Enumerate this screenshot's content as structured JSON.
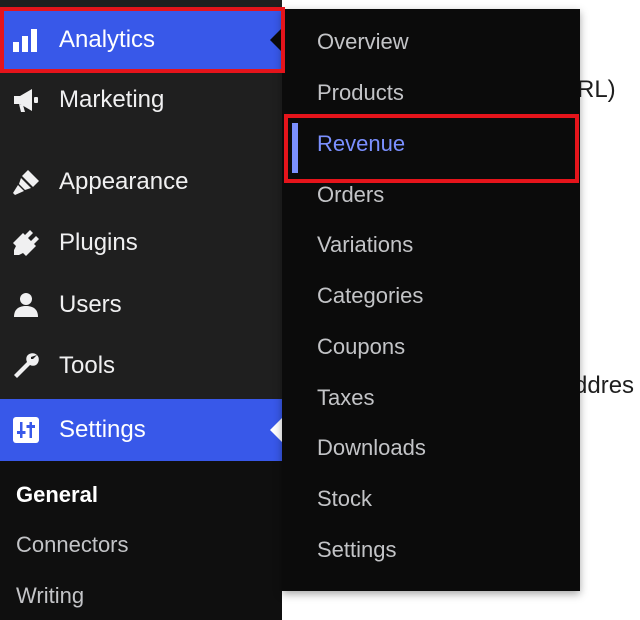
{
  "background": {
    "url_fragment": "RL)",
    "address_fragment": "ddres"
  },
  "sidebar": {
    "items": [
      {
        "label": "Analytics",
        "icon": "bar-chart-icon",
        "active": true
      },
      {
        "label": "Marketing",
        "icon": "megaphone-icon"
      },
      {
        "label": "Appearance",
        "icon": "paintbrush-icon"
      },
      {
        "label": "Plugins",
        "icon": "plug-icon"
      },
      {
        "label": "Users",
        "icon": "user-icon"
      },
      {
        "label": "Tools",
        "icon": "wrench-icon"
      },
      {
        "label": "Settings",
        "icon": "sliders-icon",
        "active": true
      }
    ],
    "settings_submenu": [
      "General",
      "Connectors",
      "Writing"
    ]
  },
  "flyout": {
    "items": [
      "Overview",
      "Products",
      "Revenue",
      "Orders",
      "Variations",
      "Categories",
      "Coupons",
      "Taxes",
      "Downloads",
      "Stock",
      "Settings"
    ],
    "selected": "Revenue"
  },
  "colors": {
    "sidebar_bg": "#1f1f1f",
    "active_bg": "#3858e9",
    "flyout_bg": "#0b0b0b",
    "selected_text": "#7b90ff",
    "highlight_border": "#e5141b"
  }
}
